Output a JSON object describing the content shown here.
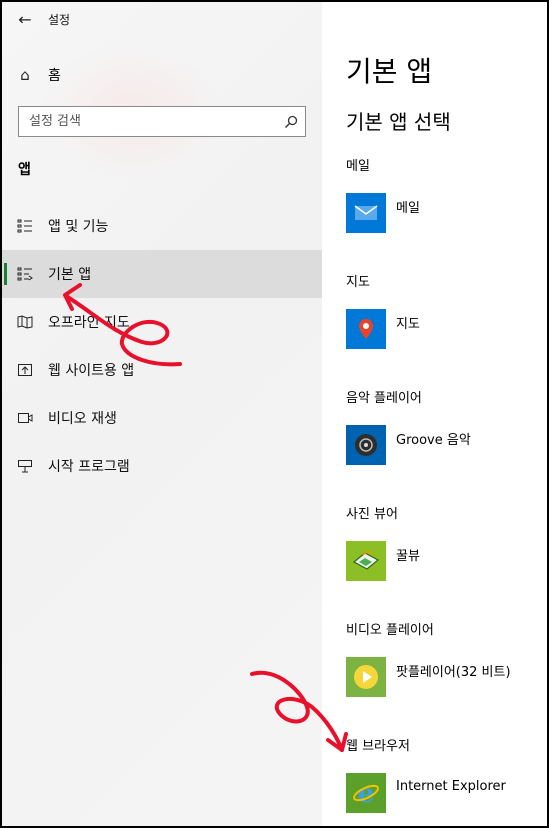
{
  "window": {
    "title": "설정"
  },
  "sidebar": {
    "home_label": "홈",
    "search_placeholder": "설정 검색",
    "section_title": "앱",
    "items": [
      {
        "label": "앱 및 기능",
        "icon": "apps-features-icon"
      },
      {
        "label": "기본 앱",
        "icon": "default-apps-icon",
        "selected": true
      },
      {
        "label": "오프라인 지도",
        "icon": "offline-maps-icon"
      },
      {
        "label": "웹 사이트용 앱",
        "icon": "apps-for-websites-icon"
      },
      {
        "label": "비디오 재생",
        "icon": "video-playback-icon"
      },
      {
        "label": "시작 프로그램",
        "icon": "startup-icon"
      }
    ]
  },
  "main": {
    "title": "기본 앱",
    "subtitle": "기본 앱 선택",
    "defaults": [
      {
        "category": "메일",
        "app": "메일",
        "tile_color": "#0078d7",
        "icon": "mail-icon"
      },
      {
        "category": "지도",
        "app": "지도",
        "tile_color": "#0078d7",
        "icon": "maps-icon"
      },
      {
        "category": "음악 플레이어",
        "app": "Groove 음악",
        "tile_color": "#0063b1",
        "icon": "groove-music-icon"
      },
      {
        "category": "사진 뷰어",
        "app": "꿀뷰",
        "tile_color": "#8cbf26",
        "icon": "honeyview-icon"
      },
      {
        "category": "비디오 플레이어",
        "app": "팟플레이어(32 비트)",
        "tile_color": "#7cb342",
        "icon": "potplayer-icon"
      },
      {
        "category": "웹 브라우저",
        "app": "Internet Explorer",
        "tile_color": "#5ba02a",
        "icon": "internet-explorer-icon"
      }
    ]
  },
  "colors": {
    "accent": "#1a7f37",
    "annotation": "#e8102a"
  }
}
